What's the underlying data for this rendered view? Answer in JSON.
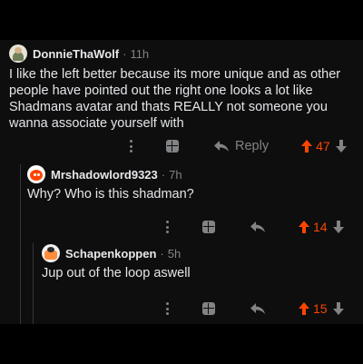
{
  "colors": {
    "background": "#0e0e0f",
    "upvote": "#ff4500",
    "muted": "#818384",
    "text": "#e4e6e8"
  },
  "comments": [
    {
      "avatar_icon": "user-avatar-icon",
      "username": "DonnieThaWolf",
      "time": "11h",
      "text": "I like the left better because its more unique and as other people have pointed out the right one looks a lot like Shadmans avatar and thats REALLY not someone you wanna associate yourself with",
      "reply_label": "Reply",
      "score": "47",
      "voted": "up"
    },
    {
      "avatar_icon": "snoo-avatar-icon",
      "username": "Mrshadowlord9323",
      "time": "7h",
      "text": "Why? Who is this shadman?",
      "score": "14",
      "voted": "up"
    },
    {
      "avatar_icon": "user-avatar-icon",
      "username": "Schapenkoppen",
      "time": "5h",
      "text": "Jup out of the loop aswell",
      "score": "15",
      "voted": "up"
    }
  ],
  "separator": "·"
}
